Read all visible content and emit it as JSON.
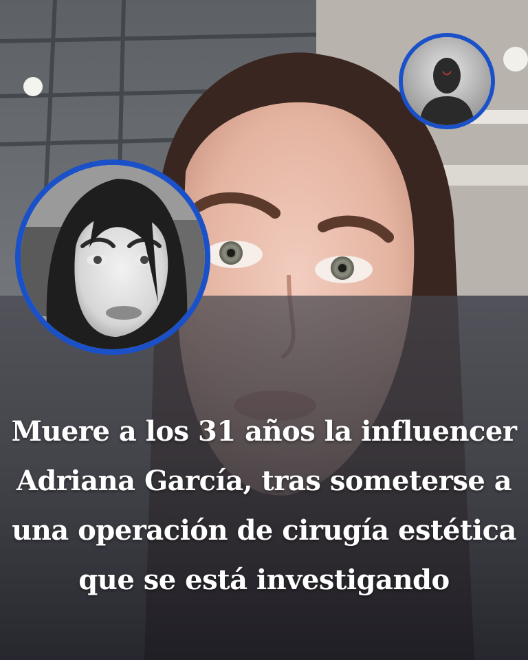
{
  "headline": {
    "line1": "Muere a los 31 años la influencer",
    "line2": "Adriana García, tras someterse a",
    "line3": "una operación de cirugía estética",
    "line4": "que se está investigando"
  },
  "accent_color": "#1a50c8"
}
